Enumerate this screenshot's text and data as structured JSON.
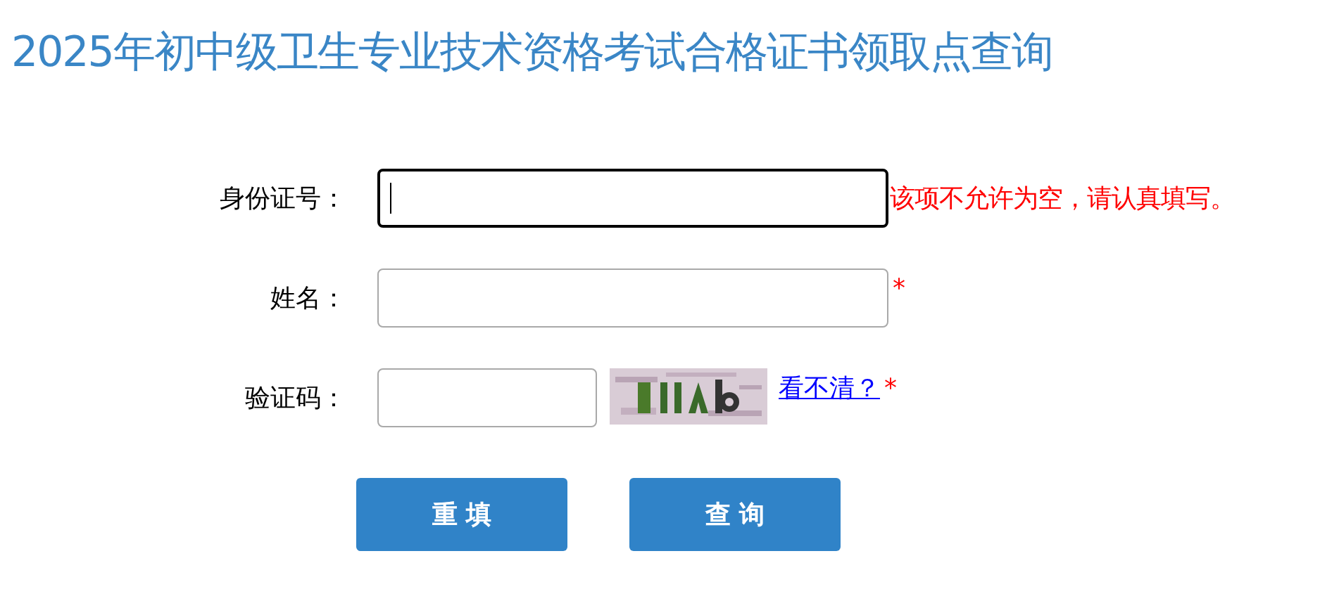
{
  "title": "2025年初中级卫生专业技术资格考试合格证书领取点查询",
  "fields": [
    {
      "kind": "text",
      "label": "身份证号：",
      "focused": true,
      "error": "该项不允许为空，请认真填写。"
    },
    {
      "kind": "text",
      "label": "姓名：",
      "focused": false,
      "required_mark": "*"
    },
    {
      "kind": "captcha",
      "label": "验证码：",
      "focused": false,
      "refresh_link": "看不清？",
      "required_mark": "*"
    }
  ],
  "buttons": [
    {
      "label": "重 填"
    },
    {
      "label": "查 询"
    }
  ]
}
